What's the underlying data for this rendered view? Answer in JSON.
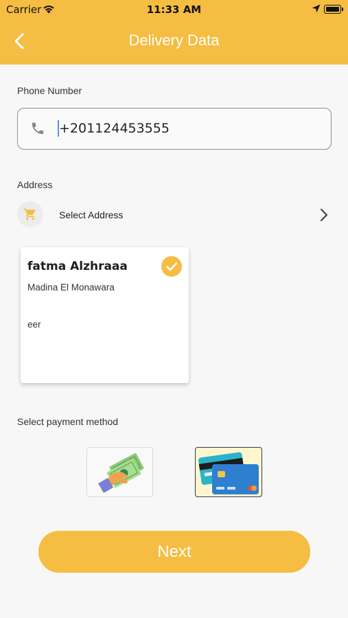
{
  "status_bar": {
    "carrier": "Carrier",
    "time": "11:33 AM"
  },
  "header": {
    "title": "Delivery Data",
    "back_icon": "chevron-left-icon"
  },
  "phone": {
    "label": "Phone Number",
    "value": "+201124453555",
    "icon": "phone-icon"
  },
  "address": {
    "label": "Address",
    "select_text": "Select Address",
    "icon": "cart-icon",
    "selected_card": {
      "name": "fatma Alzhraaa",
      "city": "Madina El Monawara",
      "note": "eer",
      "checked": true
    }
  },
  "payment": {
    "label": "Select payment method",
    "methods": [
      {
        "icon": "cash-icon",
        "selected": false
      },
      {
        "icon": "credit-card-icon",
        "selected": true
      }
    ]
  },
  "next_button": {
    "label": "Next"
  },
  "colors": {
    "accent": "#f5bd42",
    "background": "#f7f7f7",
    "header_text": "#ffffff"
  }
}
